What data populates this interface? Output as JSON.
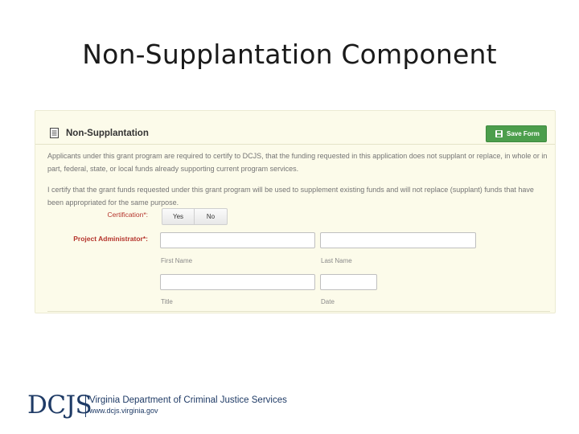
{
  "slide": {
    "title": "Non-Supplantation Component"
  },
  "form": {
    "panel_title": "Non-Supplantation",
    "save_label": "Save Form",
    "paragraph_1": "Applicants under this grant program are required to certify to DCJS, that the funding requested in this application does not supplant or replace, in whole or in part, federal, state, or local funds already supporting current program services.",
    "paragraph_2": "I certify that the grant funds requested under this grant program will be used to supplement existing funds and will not replace (supplant) funds that have been appropriated for the same purpose.",
    "certification": {
      "label": "Certification*:",
      "options": [
        "Yes",
        "No"
      ]
    },
    "administrator": {
      "label": "Project Administrator*:",
      "first_name": {
        "value": "",
        "hint": "First Name"
      },
      "last_name": {
        "value": "",
        "hint": "Last Name"
      },
      "title": {
        "value": "",
        "hint": "Title"
      },
      "date": {
        "value": "",
        "hint": "Date"
      }
    }
  },
  "footer": {
    "logo_mark": "DCJS",
    "org_name": "Virginia Department of Criminal Justice Services",
    "url": "www.dcjs.virginia.gov"
  },
  "colors": {
    "panel_bg": "#fcfbea",
    "save_button": "#4c9e4c",
    "required_label": "#b5342c",
    "logo_blue": "#1f3b66"
  },
  "icons": {
    "header": "document-icon",
    "save": "floppy-disk-icon"
  }
}
